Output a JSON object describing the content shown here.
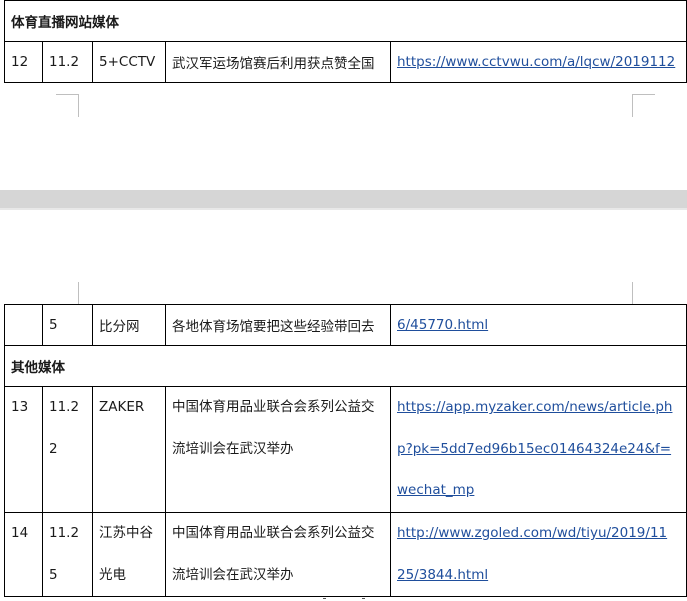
{
  "table_top": {
    "section_header": "体育直播网站媒体",
    "row": {
      "no": "12",
      "date": "11.2",
      "media": "5+CCTV",
      "title": "武汉军运场馆赛后利用获点赞全国",
      "url": "https://www.cctvwu.com/a/lqcw/2019112"
    }
  },
  "table_bottom": {
    "continued_row": {
      "no": "",
      "date": "5",
      "media": "比分网",
      "title": "各地体育场馆要把这些经验带回去",
      "url": "6/45770.html"
    },
    "section_header": "其他媒体",
    "rows": [
      {
        "no": "13",
        "date_lines": [
          "11.2",
          "2"
        ],
        "media_lines": [
          "ZAKER"
        ],
        "title_lines": [
          "中国体育用品业联合会系列公益交",
          "流培训会在武汉举办"
        ],
        "url_lines": [
          "https://app.myzaker.com/news/article.ph",
          "p?pk=5dd7ed96b15ec01464324e24&f=",
          "wechat_mp"
        ]
      },
      {
        "no": "14",
        "date_lines": [
          "11.2",
          "5"
        ],
        "media_lines": [
          "江苏中谷",
          "光电"
        ],
        "title_lines": [
          "中国体育用品业联合会系列公益交",
          "流培训会在武汉举办"
        ],
        "url_lines": [
          "http://www.zgoled.com/wd/tiyu/2019/11",
          "25/3844.html"
        ]
      }
    ]
  }
}
